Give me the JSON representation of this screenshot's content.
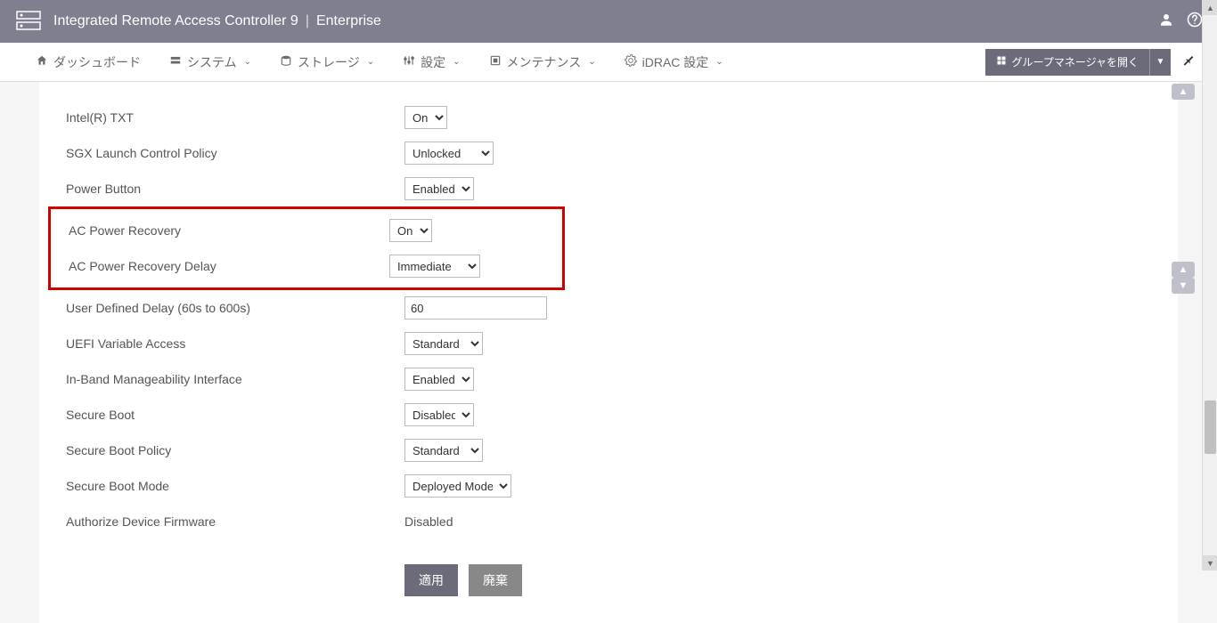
{
  "header": {
    "title": "Integrated Remote Access Controller 9",
    "edition": "Enterprise"
  },
  "nav": {
    "dashboard": "ダッシュボード",
    "system": "システム",
    "storage": "ストレージ",
    "settings": "設定",
    "maintenance": "メンテナンス",
    "idrac_settings": "iDRAC 設定",
    "group_manager": "グループマネージャを開く"
  },
  "form": {
    "intel_txt": {
      "label": "Intel(R) TXT",
      "value": "On"
    },
    "sgx_policy": {
      "label": "SGX Launch Control Policy",
      "value": "Unlocked"
    },
    "power_button": {
      "label": "Power Button",
      "value": "Enabled"
    },
    "ac_recovery": {
      "label": "AC Power Recovery",
      "value": "On"
    },
    "ac_recovery_delay": {
      "label": "AC Power Recovery Delay",
      "value": "Immediate"
    },
    "user_delay": {
      "label": "User Defined Delay (60s to 600s)",
      "value": "60"
    },
    "uefi_var": {
      "label": "UEFI Variable Access",
      "value": "Standard"
    },
    "inband": {
      "label": "In-Band Manageability Interface",
      "value": "Enabled"
    },
    "secure_boot": {
      "label": "Secure Boot",
      "value": "Disabled"
    },
    "secure_boot_policy": {
      "label": "Secure Boot Policy",
      "value": "Standard"
    },
    "secure_boot_mode": {
      "label": "Secure Boot Mode",
      "value": "Deployed Mode"
    },
    "authorize_fw": {
      "label": "Authorize Device Firmware",
      "value": "Disabled"
    }
  },
  "buttons": {
    "apply": "適用",
    "discard": "廃棄"
  }
}
